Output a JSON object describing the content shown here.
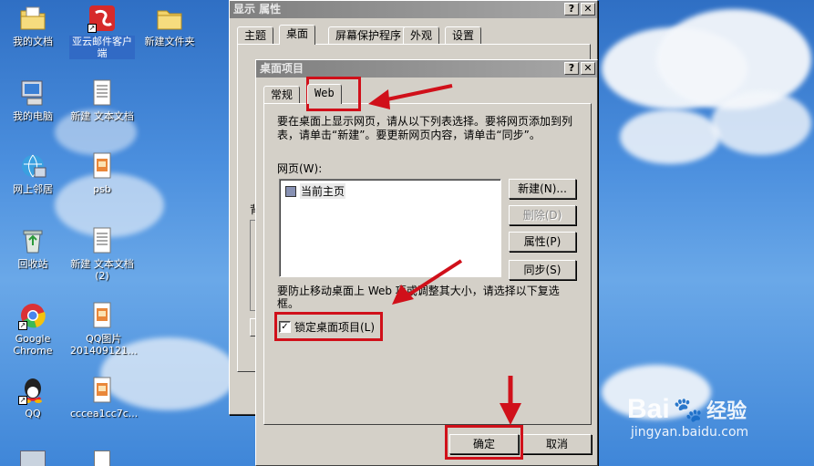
{
  "desktop": {
    "icons": [
      {
        "label": "我的文档",
        "icon": "folder-docs-icon"
      },
      {
        "label": "亚云邮件客户端",
        "icon": "mail-app-icon"
      },
      {
        "label": "新建文件夹",
        "icon": "folder-icon"
      },
      {
        "label": "我的电脑",
        "icon": "computer-icon"
      },
      {
        "label": "新建 文本文档",
        "icon": "text-file-icon"
      },
      {
        "label": "网上邻居",
        "icon": "network-icon"
      },
      {
        "label": "psb",
        "icon": "image-file-icon"
      },
      {
        "label": "回收站",
        "icon": "recycle-bin-icon"
      },
      {
        "label": "新建 文本文档 (2)",
        "icon": "text-file-icon"
      },
      {
        "label": "Google Chrome",
        "icon": "chrome-icon"
      },
      {
        "label": "QQ图片201409121...",
        "icon": "image-file-icon"
      },
      {
        "label": "QQ",
        "icon": "qq-icon"
      },
      {
        "label": "cccea1cc7c...",
        "icon": "image-file-icon"
      }
    ]
  },
  "display_window": {
    "title": "显示 属性",
    "help_btn": "?",
    "close_btn": "✕",
    "tabs": [
      "主题",
      "桌面",
      "屏幕保护程序",
      "外观",
      "设置"
    ],
    "partial_label": "背"
  },
  "desktop_items_dialog": {
    "title": "桌面项目",
    "help_btn": "?",
    "close_btn": "✕",
    "tabs": [
      "常规",
      "Web"
    ],
    "instructions": "要在桌面上显示网页，请从以下列表选择。要将网页添加到列表，请单击“新建”。要更新网页内容，请单击“同步”。",
    "webpages_label": "网页(W):",
    "list_items": [
      {
        "label": "当前主页",
        "checked": false
      }
    ],
    "buttons": {
      "new": "新建(N)...",
      "delete": "删除(D)",
      "properties": "属性(P)",
      "sync": "同步(S)"
    },
    "lock_description": "要防止移动桌面上 Web 项或调整其大小，请选择以下复选框。",
    "lock_checkbox_label": "锁定桌面项目(L)",
    "lock_checked": true,
    "ok": "确定",
    "cancel": "取消"
  },
  "watermark": {
    "brand": "Bai",
    "brand2": "经验",
    "url": "jingyan.baidu.com"
  },
  "annotation_color": "#d0101a"
}
